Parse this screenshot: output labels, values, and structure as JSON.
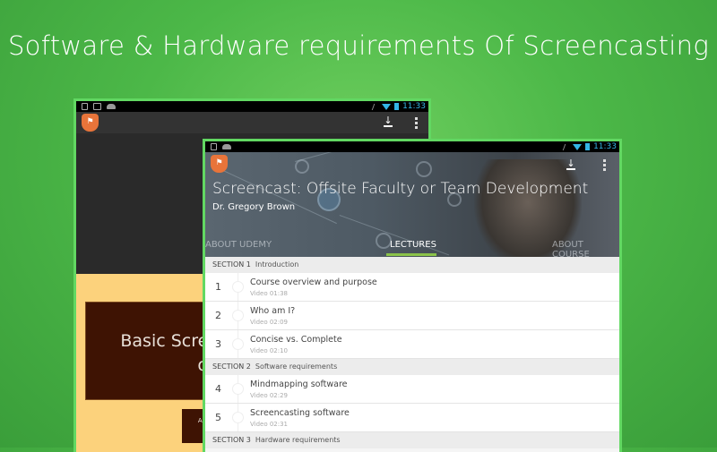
{
  "headline": "Software & Hardware requirements Of Screencasting",
  "status_bar": {
    "time": "11:33"
  },
  "back_device": {
    "slide_title": "Basic Scree",
    "slide_title_line2": "on",
    "slide_caption": "Associ",
    "slide_caption_line2": "U"
  },
  "front_device": {
    "course_title": "Screencast:  Offsite Faculty or Team Development",
    "author": "Dr. Gregory Brown",
    "tabs": [
      {
        "label": "ABOUT UDEMY"
      },
      {
        "label": "LECTURES",
        "active": true
      },
      {
        "label": "ABOUT COURSE"
      }
    ],
    "sections": [
      {
        "label": "SECTION 1",
        "name": "Introduction",
        "lectures": [
          {
            "num": "1",
            "title": "Course overview and purpose",
            "meta": "Video 01:38"
          },
          {
            "num": "2",
            "title": "Who am I?",
            "meta": "Video 02:09"
          },
          {
            "num": "3",
            "title": "Concise vs. Complete",
            "meta": "Video 02:10"
          }
        ]
      },
      {
        "label": "SECTION 2",
        "name": "Software requirements",
        "lectures": [
          {
            "num": "4",
            "title": "Mindmapping software",
            "meta": "Video 02:29"
          },
          {
            "num": "5",
            "title": "Screencasting software",
            "meta": "Video 02:31"
          }
        ]
      },
      {
        "label": "SECTION 3",
        "name": "Hardware requirements",
        "lectures": []
      }
    ]
  },
  "colors": {
    "background": "#4cb848",
    "device_border": "#62d862",
    "tab_indicator": "#8bc34a",
    "status_accent": "#33b5e5",
    "logo": "#e8743a"
  }
}
